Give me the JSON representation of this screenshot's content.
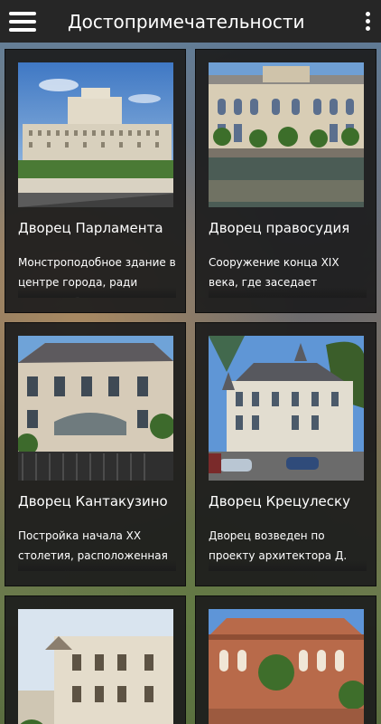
{
  "appbar": {
    "title": "Достопримечательности",
    "menu_icon": "hamburger-menu-icon",
    "more_icon": "more-vertical-icon"
  },
  "cards": [
    {
      "title": "Дворец Парламента",
      "description": "Монстроподобное здание в центре города, ради которого было снесено значительное"
    },
    {
      "title": "Дворец правосудия",
      "description": "Сооружение конца XIX века, где заседает городской апелляционный суд. Роскошный"
    },
    {
      "title": "Дворец Кантакузино",
      "description": "Постройка начала XX столетия, расположенная на одной из самых старых городских улиц"
    },
    {
      "title": "Дворец Крецулеску",
      "description": "Дворец возведен по проекту архитектора Д. Антонеску в начале XX века, здание"
    }
  ]
}
